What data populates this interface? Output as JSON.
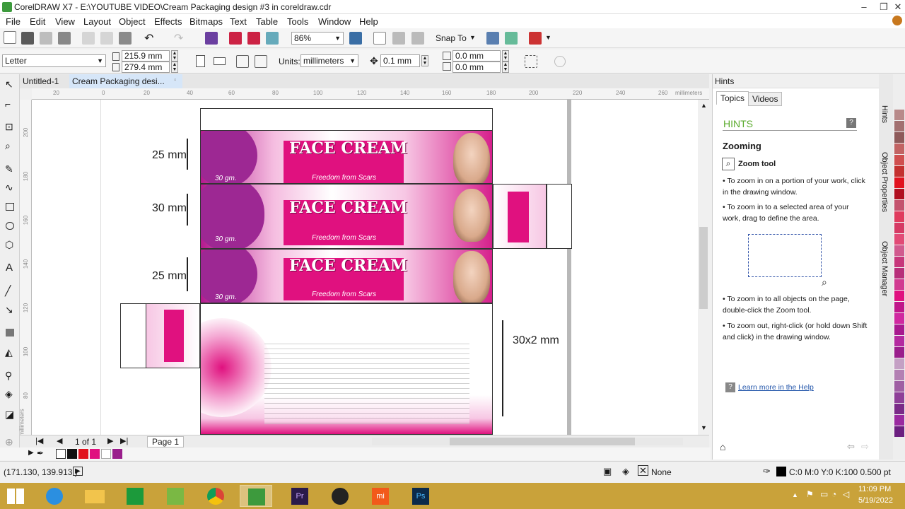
{
  "title": "CorelDRAW X7 - E:\\YOUTUBE VIDEO\\Cream Packaging design #3 in coreldraw.cdr",
  "menu": [
    "File",
    "Edit",
    "View",
    "Layout",
    "Object",
    "Effects",
    "Bitmaps",
    "Text",
    "Table",
    "Tools",
    "Window",
    "Help"
  ],
  "toolbar": {
    "zoom": "86%",
    "snap_label": "Snap To"
  },
  "property": {
    "page_size": "Letter",
    "width": "215.9 mm",
    "height": "279.4 mm",
    "units_label": "Units:",
    "units": "millimeters",
    "nudge": "0.1 mm",
    "dup_x": "0.0 mm",
    "dup_y": "0.0 mm"
  },
  "tabs": [
    "Untitled-1",
    "Cream Packaging desi..."
  ],
  "ruler": {
    "h_ticks": [
      "20",
      "0",
      "20",
      "40",
      "60",
      "80",
      "100",
      "120",
      "140",
      "160",
      "180",
      "200",
      "220",
      "240",
      "260"
    ],
    "h_unit": "millimeters",
    "v_ticks": [
      "200",
      "180",
      "160",
      "140",
      "120",
      "100",
      "80"
    ],
    "v_unit": "millimeters"
  },
  "design": {
    "product": "FACE CREAM",
    "tagline": "Freedom from Scars",
    "weight": "30 gm.",
    "dims": [
      "25 mm",
      "30 mm",
      "25 mm",
      "30x2  mm"
    ]
  },
  "pagebar": {
    "count": "1 of 1",
    "page": "Page 1"
  },
  "status": {
    "coords": "(171.130, 139.913 )",
    "fill": "None",
    "outline": "C:0 M:0 Y:0 K:100  0.500 pt"
  },
  "hints_panel": {
    "header": "Hints",
    "tabs": [
      "Topics",
      "Videos"
    ],
    "heading": "HINTS",
    "subheading": "Zooming",
    "tool_label": "Zoom tool",
    "bullets": [
      "To zoom in on a portion of your work, click in the drawing window.",
      "To zoom in to a selected area of your work, drag to define the area.",
      "To zoom in to all objects on the page, double-click the Zoom tool.",
      "To zoom out, right-click (or hold down Shift and click) in the drawing window."
    ],
    "learn_more": "Learn more in the Help"
  },
  "dockers": [
    "Hints",
    "Object Properties",
    "Object Manager"
  ],
  "taskbar": {
    "time": "11:09 PM",
    "date": "5/19/2022"
  },
  "colors": {
    "accent_pink": "#e0117f",
    "purple": "#9a1e8c",
    "taskbar": "#c9a23a"
  }
}
